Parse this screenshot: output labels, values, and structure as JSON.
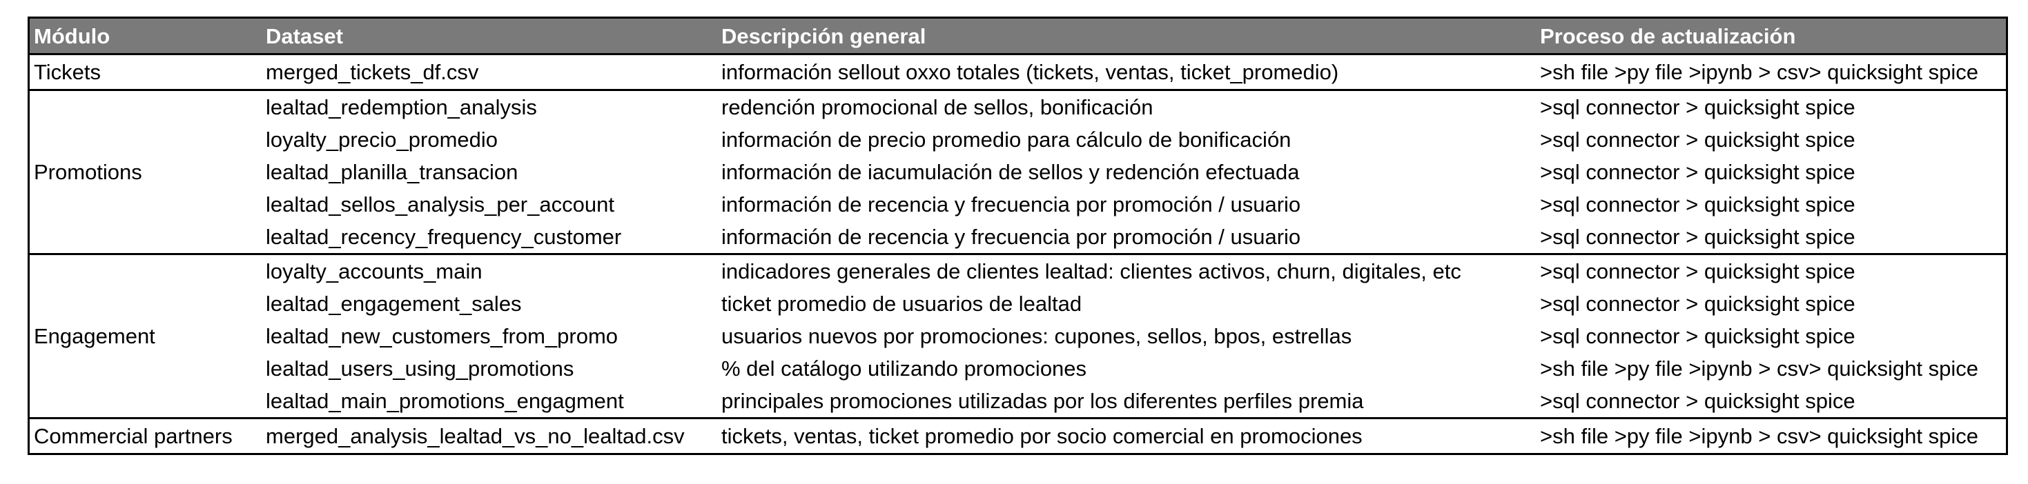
{
  "table": {
    "headers": {
      "modulo": "Módulo",
      "dataset": "Dataset",
      "descripcion": "Descripción general",
      "proceso": "Proceso de actualización"
    },
    "groups": [
      {
        "modulo": "Tickets",
        "rows": [
          {
            "dataset": "merged_tickets_df.csv",
            "descripcion": "información sellout oxxo totales (tickets, ventas, ticket_promedio)",
            "proceso": ">sh file >py file >ipynb > csv> quicksight spice"
          }
        ]
      },
      {
        "modulo": "Promotions",
        "rows": [
          {
            "dataset": "lealtad_redemption_analysis",
            "descripcion": "redención promocional de sellos, bonificación",
            "proceso": ">sql connector > quicksight spice"
          },
          {
            "dataset": "loyalty_precio_promedio",
            "descripcion": "información de precio promedio para cálculo de bonificación",
            "proceso": ">sql connector > quicksight spice"
          },
          {
            "dataset": "lealtad_planilla_transacion",
            "descripcion": "información de iacumulación de sellos y redención efectuada",
            "proceso": ">sql connector > quicksight spice"
          },
          {
            "dataset": "lealtad_sellos_analysis_per_account",
            "descripcion": "información de recencia y frecuencia por promoción / usuario",
            "proceso": ">sql connector > quicksight spice"
          },
          {
            "dataset": "lealtad_recency_frequency_customer",
            "descripcion": "información de recencia y frecuencia por promoción / usuario",
            "proceso": ">sql connector > quicksight spice"
          }
        ]
      },
      {
        "modulo": "Engagement",
        "rows": [
          {
            "dataset": "loyalty_accounts_main",
            "descripcion": "indicadores generales de clientes lealtad: clientes activos, churn, digitales, etc",
            "proceso": ">sql connector > quicksight spice"
          },
          {
            "dataset": "lealtad_engagement_sales",
            "descripcion": "ticket promedio de usuarios de lealtad",
            "proceso": ">sql connector > quicksight spice"
          },
          {
            "dataset": "lealtad_new_customers_from_promo",
            "descripcion": "usuarios nuevos por promociones: cupones, sellos, bpos, estrellas",
            "proceso": ">sql connector > quicksight spice"
          },
          {
            "dataset": "lealtad_users_using_promotions",
            "descripcion": "% del catálogo utilizando promociones",
            "proceso": ">sh file >py file >ipynb > csv> quicksight spice"
          },
          {
            "dataset": "lealtad_main_promotions_engagment",
            "descripcion": "principales promociones utilizadas por los diferentes perfiles premia",
            "proceso": ">sql connector > quicksight spice"
          }
        ]
      },
      {
        "modulo": "Commercial partners",
        "rows": [
          {
            "dataset": "merged_analysis_lealtad_vs_no_lealtad.csv",
            "descripcion": "tickets, ventas, ticket promedio por socio comercial en promociones",
            "proceso": ">sh file >py file >ipynb > csv> quicksight spice"
          }
        ]
      }
    ]
  }
}
